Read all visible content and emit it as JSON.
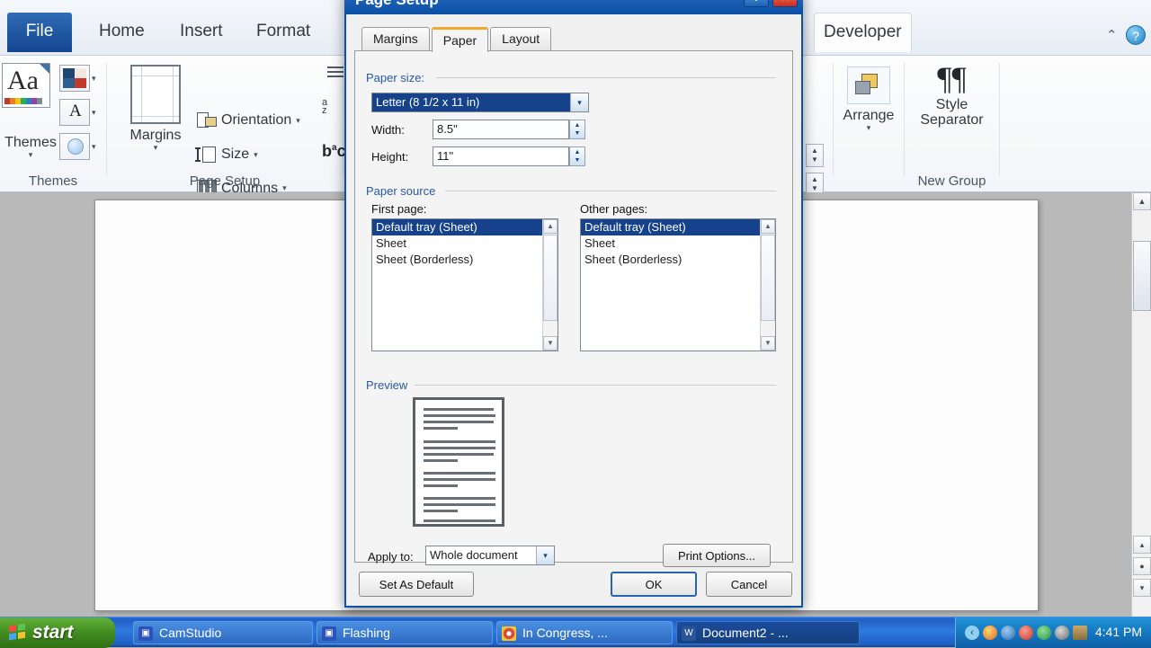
{
  "app": {
    "ribbon_tabs": [
      {
        "label": "File",
        "id": "file"
      },
      {
        "label": "Home",
        "id": "home"
      },
      {
        "label": "Insert",
        "id": "insert"
      },
      {
        "label": "Format",
        "id": "format"
      },
      {
        "label": "Developer",
        "id": "developer"
      }
    ],
    "groups": {
      "themes": {
        "label": "Themes",
        "main_button": "Themes",
        "caret": "▾"
      },
      "page_setup": {
        "label": "Page Setup",
        "margins": "Margins",
        "orientation": "Orientation",
        "size": "Size",
        "columns": "Columns",
        "caret": "▾"
      },
      "arrange": {
        "label": "",
        "button": "Arrange",
        "caret": "▾"
      },
      "new_group": {
        "label": "New Group",
        "button": "Style Separator"
      }
    },
    "help_icon": "?",
    "collapse_icon": "⌃"
  },
  "dialog": {
    "title": "Page Setup",
    "titlebar_buttons": [
      {
        "name": "help",
        "glyph": "?"
      },
      {
        "name": "close",
        "glyph": "✕"
      }
    ],
    "tabs": [
      {
        "label": "Margins",
        "selected": false
      },
      {
        "label": "Paper",
        "selected": true
      },
      {
        "label": "Layout",
        "selected": false
      }
    ],
    "paper_size": {
      "caption": "Paper size:",
      "selected": "Letter (8 1/2 x 11 in)",
      "arrow": "▾",
      "width_label": "Width:",
      "width_value": "8.5\"",
      "height_label": "Height:",
      "height_value": "11\"",
      "spin_up": "▲",
      "spin_down": "▼"
    },
    "paper_source": {
      "caption": "Paper source",
      "first_page_label": "First page:",
      "other_pages_label": "Other pages:",
      "first_page_items": [
        "Default tray (Sheet)",
        "Sheet",
        "Sheet (Borderless)"
      ],
      "other_pages_items": [
        "Default tray (Sheet)",
        "Sheet",
        "Sheet (Borderless)"
      ],
      "first_page_selected_index": 0,
      "other_pages_selected_index": 0,
      "scroll_up": "▲",
      "scroll_down": "▼"
    },
    "preview": {
      "caption": "Preview",
      "apply_to_label": "Apply to:",
      "apply_to_value": "Whole document",
      "apply_to_arrow": "▾",
      "print_options_button": "Print Options..."
    },
    "footer": {
      "set_as_default": "Set As Default",
      "ok": "OK",
      "cancel": "Cancel"
    }
  },
  "scrollbar": {
    "up": "▲",
    "down": "▼",
    "prev_page": "▴",
    "select_object": "●",
    "next_page": "▾"
  },
  "taskbar": {
    "start": "start",
    "items": [
      {
        "label": "CamStudio",
        "icon": "camstudio-icon",
        "icon_glyph": "▣",
        "icon_color": "#2b53b8",
        "active": false
      },
      {
        "label": "Flashing",
        "icon": "camstudio-icon",
        "icon_glyph": "▣",
        "icon_color": "#2b53b8",
        "active": false
      },
      {
        "label": "In Congress, ...",
        "icon": "chrome-icon",
        "icon_glyph": "●",
        "icon_color": "#d94c3d",
        "active": false
      },
      {
        "label": "Document2 - ...",
        "icon": "word-icon",
        "icon_glyph": "W",
        "icon_color": "#2a5699",
        "active": true
      }
    ],
    "tray_icons": [
      "chevron-left-icon",
      "network-icon",
      "volume-icon",
      "shield-icon",
      "globe-icon",
      "plug-icon",
      "keyboard-icon"
    ],
    "clock": "4:41 PM"
  },
  "colors": {
    "accent": "#15428b",
    "dialog_border": "#0a52a8",
    "tab_active_accent": "#f0a92c",
    "taskbar_blue": "#2f7ae0",
    "start_green": "#3f8a1e"
  }
}
